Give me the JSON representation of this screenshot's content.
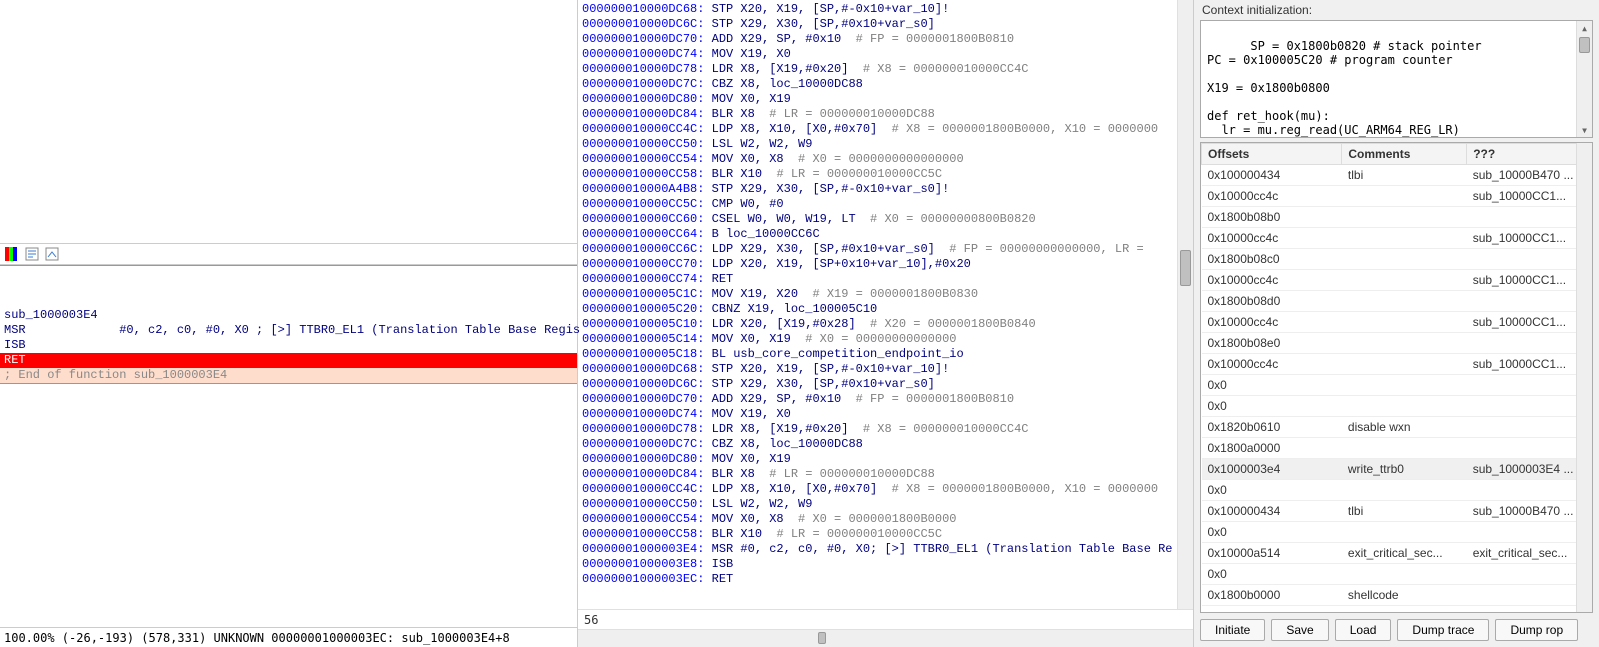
{
  "left": {
    "func_label": "sub_1000003E4",
    "lines": [
      "MSR             #0, c2, c0, #0, X0 ; [>] TTBR0_EL1 (Translation Table Base Regis",
      "ISB"
    ],
    "ret_line": "RET",
    "end_line": "; End of function sub_1000003E4"
  },
  "status": "100.00% (-26,-193) (578,331) UNKNOWN 00000001000003EC: sub_1000003E4+8",
  "middle_count": "56",
  "middle": [
    {
      "a": "000000010000DC68",
      "t": "STP X20, X19, [SP,#-0x10+var_10]!"
    },
    {
      "a": "000000010000DC6C",
      "t": "STP X29, X30, [SP,#0x10+var_s0]"
    },
    {
      "a": "000000010000DC70",
      "t": "ADD X29, SP, #0x10",
      "c": "  # FP = 0000001800B0810"
    },
    {
      "a": "000000010000DC74",
      "t": "MOV X19, X0"
    },
    {
      "a": "000000010000DC78",
      "t": "LDR X8, [X19,#0x20]",
      "c": "  # X8 = 000000010000CC4C"
    },
    {
      "a": "000000010000DC7C",
      "t": "CBZ X8, loc_10000DC88"
    },
    {
      "a": "000000010000DC80",
      "t": "MOV X0, X19"
    },
    {
      "a": "000000010000DC84",
      "t": "BLR X8",
      "c": "  # LR = 000000010000DC88"
    },
    {
      "a": "000000010000CC4C",
      "t": "LDP X8, X10, [X0,#0x70]",
      "c": "  # X8 = 0000001800B0000, X10 = 0000000"
    },
    {
      "a": "000000010000CC50",
      "t": "LSL W2, W2, W9"
    },
    {
      "a": "000000010000CC54",
      "t": "MOV X0, X8",
      "c": "  # X0 = 0000000000000000"
    },
    {
      "a": "000000010000CC58",
      "t": "BLR X10",
      "c": "  # LR = 000000010000CC5C"
    },
    {
      "a": "000000010000A4B8",
      "t": "STP X29, X30, [SP,#-0x10+var_s0]!"
    },
    {
      "a": "000000010000CC5C",
      "t": "CMP W0, #0"
    },
    {
      "a": "000000010000CC60",
      "t": "CSEL W0, W0, W19, LT",
      "c": "  # X0 = 00000000800B0820"
    },
    {
      "a": "000000010000CC64",
      "t": "B loc_10000CC6C"
    },
    {
      "a": "000000010000CC6C",
      "t": "LDP X29, X30, [SP,#0x10+var_s0]",
      "c": "  # FP = 00000000000000, LR = "
    },
    {
      "a": "000000010000CC70",
      "t": "LDP X20, X19, [SP+0x10+var_10],#0x20"
    },
    {
      "a": "000000010000CC74",
      "t": "RET"
    },
    {
      "a": "0000000100005C1C",
      "t": "MOV X19, X20",
      "c": "  # X19 = 0000001800B0830"
    },
    {
      "a": "0000000100005C20",
      "t": "CBNZ X19, loc_100005C10"
    },
    {
      "a": "0000000100005C10",
      "t": "LDR X20, [X19,#0x28]",
      "c": "  # X20 = 0000001800B0840"
    },
    {
      "a": "0000000100005C14",
      "t": "MOV X0, X19",
      "c": "  # X0 = 00000000000000"
    },
    {
      "a": "0000000100005C18",
      "t": "BL usb_core_competition_endpoint_io"
    },
    {
      "a": "000000010000DC68",
      "t": "STP X20, X19, [SP,#-0x10+var_10]!"
    },
    {
      "a": "000000010000DC6C",
      "t": "STP X29, X30, [SP,#0x10+var_s0]"
    },
    {
      "a": "000000010000DC70",
      "t": "ADD X29, SP, #0x10",
      "c": "  # FP = 0000001800B0810"
    },
    {
      "a": "000000010000DC74",
      "t": "MOV X19, X0"
    },
    {
      "a": "000000010000DC78",
      "t": "LDR X8, [X19,#0x20]",
      "c": "  # X8 = 000000010000CC4C"
    },
    {
      "a": "000000010000DC7C",
      "t": "CBZ X8, loc_10000DC88"
    },
    {
      "a": "000000010000DC80",
      "t": "MOV X0, X19"
    },
    {
      "a": "000000010000DC84",
      "t": "BLR X8",
      "c": "  # LR = 000000010000DC88"
    },
    {
      "a": "000000010000CC4C",
      "t": "LDP X8, X10, [X0,#0x70]",
      "c": "  # X8 = 0000001800B0000, X10 = 0000000"
    },
    {
      "a": "000000010000CC50",
      "t": "LSL W2, W2, W9"
    },
    {
      "a": "000000010000CC54",
      "t": "MOV X0, X8",
      "c": "  # X0 = 0000001800B0000"
    },
    {
      "a": "000000010000CC58",
      "t": "BLR X10",
      "c": "  # LR = 000000010000CC5C"
    },
    {
      "a": "00000001000003E4",
      "t": "MSR #0, c2, c0, #0, X0; [>] TTBR0_EL1 (Translation Table Base Re"
    },
    {
      "a": "00000001000003E8",
      "t": "ISB"
    },
    {
      "a": "00000001000003EC",
      "t": "RET"
    }
  ],
  "right": {
    "title": "Context initialization:",
    "script": "SP = 0x1800b0820 # stack pointer\nPC = 0x100005C20 # program counter\n\nX19 = 0x1800b0800\n\ndef ret_hook(mu):\n  lr = mu.reg_read(UC_ARM64_REG_LR)",
    "headers": [
      "Offsets",
      "Comments",
      "???"
    ],
    "rows": [
      {
        "o": "0x100000434",
        "c": "tlbi",
        "x": "sub_10000B470 ..."
      },
      {
        "o": "0x10000cc4c",
        "c": "",
        "x": "sub_10000CC1..."
      },
      {
        "o": "0x1800b08b0",
        "c": "",
        "x": ""
      },
      {
        "o": "0x10000cc4c",
        "c": "",
        "x": "sub_10000CC1..."
      },
      {
        "o": "0x1800b08c0",
        "c": "",
        "x": ""
      },
      {
        "o": "0x10000cc4c",
        "c": "",
        "x": "sub_10000CC1..."
      },
      {
        "o": "0x1800b08d0",
        "c": "",
        "x": ""
      },
      {
        "o": "0x10000cc4c",
        "c": "",
        "x": "sub_10000CC1..."
      },
      {
        "o": "0x1800b08e0",
        "c": "",
        "x": ""
      },
      {
        "o": "0x10000cc4c",
        "c": "",
        "x": "sub_10000CC1..."
      },
      {
        "o": "0x0",
        "c": "",
        "x": ""
      },
      {
        "o": "0x0",
        "c": "",
        "x": ""
      },
      {
        "o": "0x1820b0610",
        "c": "disable wxn",
        "x": ""
      },
      {
        "o": "0x1800a0000",
        "c": "",
        "x": ""
      },
      {
        "o": "0x1000003e4",
        "c": "write_ttrb0",
        "x": "sub_1000003E4 ...",
        "sel": true
      },
      {
        "o": "0x0",
        "c": "",
        "x": ""
      },
      {
        "o": "0x100000434",
        "c": "tlbi",
        "x": "sub_10000B470 ..."
      },
      {
        "o": "0x0",
        "c": "",
        "x": ""
      },
      {
        "o": "0x10000a514",
        "c": "exit_critical_sec...",
        "x": "exit_critical_sec..."
      },
      {
        "o": "0x0",
        "c": "",
        "x": ""
      },
      {
        "o": "0x1800b0000",
        "c": "shellcode",
        "x": ""
      }
    ],
    "buttons": [
      "Initiate",
      "Save",
      "Load",
      "Dump trace",
      "Dump rop"
    ]
  }
}
